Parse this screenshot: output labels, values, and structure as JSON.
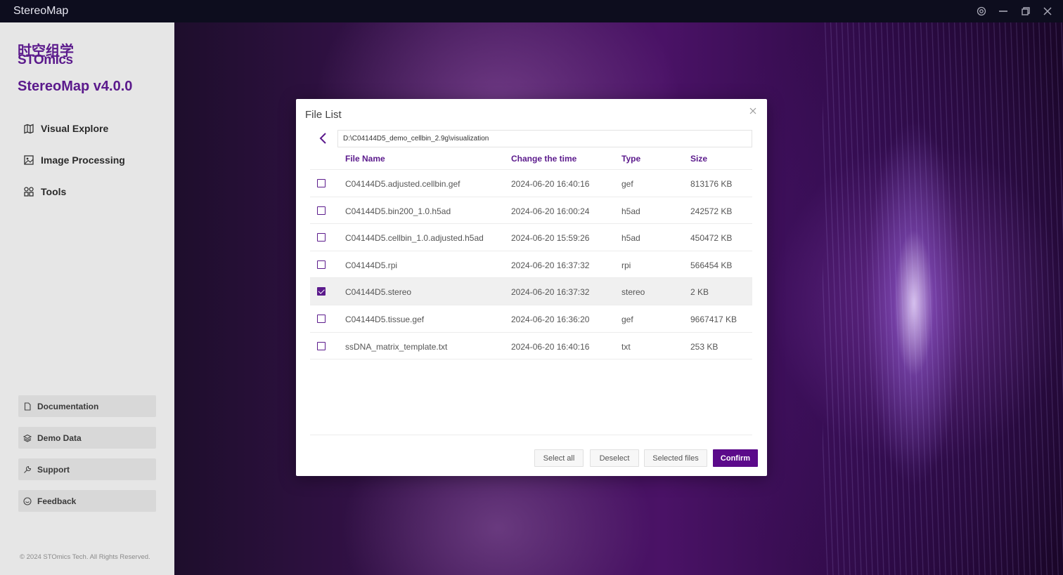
{
  "window": {
    "title": "StereoMap"
  },
  "sidebar": {
    "logo_cn": "时空组学",
    "logo_en": "STOmics",
    "version": "StereoMap v4.0.0",
    "nav": [
      {
        "label": "Visual Explore",
        "icon": "map-icon"
      },
      {
        "label": "Image Processing",
        "icon": "image-icon"
      },
      {
        "label": "Tools",
        "icon": "grid-icon"
      }
    ],
    "links": [
      {
        "label": "Documentation",
        "icon": "document-icon"
      },
      {
        "label": "Demo Data",
        "icon": "layers-icon"
      },
      {
        "label": "Support",
        "icon": "wrench-icon"
      },
      {
        "label": "Feedback",
        "icon": "smile-icon"
      }
    ],
    "copyright": "© 2024 STOmics Tech. All Rights Reserved."
  },
  "dialog": {
    "title": "File List",
    "path": "D:\\C04144D5_demo_cellbin_2.9g\\visualization",
    "columns": {
      "name": "File Name",
      "time": "Change the time",
      "type": "Type",
      "size": "Size"
    },
    "files": [
      {
        "name": "C04144D5.adjusted.cellbin.gef",
        "time": "2024-06-20 16:40:16",
        "type": "gef",
        "size": "813176 KB",
        "checked": false
      },
      {
        "name": "C04144D5.bin200_1.0.h5ad",
        "time": "2024-06-20 16:00:24",
        "type": "h5ad",
        "size": "242572 KB",
        "checked": false
      },
      {
        "name": "C04144D5.cellbin_1.0.adjusted.h5ad",
        "time": "2024-06-20 15:59:26",
        "type": "h5ad",
        "size": "450472 KB",
        "checked": false
      },
      {
        "name": "C04144D5.rpi",
        "time": "2024-06-20 16:37:32",
        "type": "rpi",
        "size": "566454 KB",
        "checked": false
      },
      {
        "name": "C04144D5.stereo",
        "time": "2024-06-20 16:37:32",
        "type": "stereo",
        "size": "2 KB",
        "checked": true
      },
      {
        "name": "C04144D5.tissue.gef",
        "time": "2024-06-20 16:36:20",
        "type": "gef",
        "size": "9667417 KB",
        "checked": false
      },
      {
        "name": "ssDNA_matrix_template.txt",
        "time": "2024-06-20 16:40:16",
        "type": "txt",
        "size": "253 KB",
        "checked": false
      }
    ],
    "buttons": {
      "select_all": "Select all",
      "deselect": "Deselect",
      "selected_files": "Selected files",
      "confirm": "Confirm"
    }
  },
  "colors": {
    "accent": "#5b1a8c",
    "primary_button": "#5b0a8a",
    "titlebar": "#0d0d1e",
    "sidebar": "#e6e6e6"
  }
}
